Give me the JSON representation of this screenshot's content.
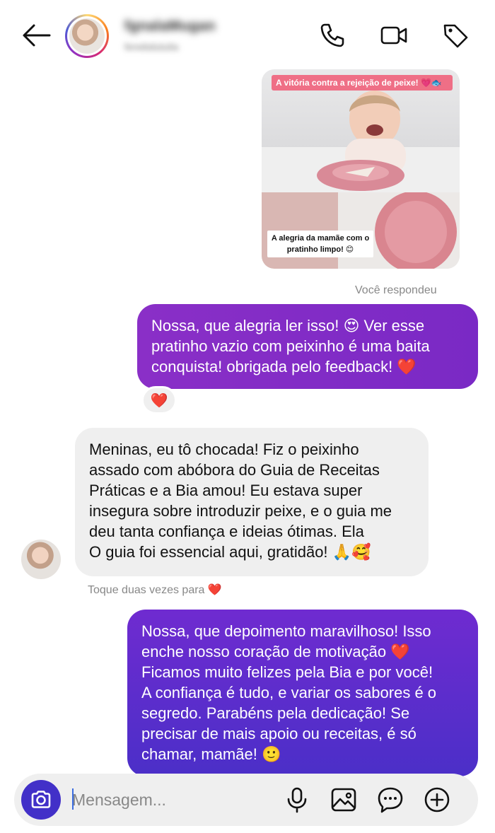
{
  "header": {
    "username": "fgnalaMugan",
    "handle": "fenebdutulia",
    "icons": [
      "back-arrow-icon",
      "phone-icon",
      "video-camera-icon",
      "tag-icon"
    ]
  },
  "shared_card": {
    "caption_top": "A vitória contra a rejeição de peixe! 💗🐟",
    "caption_bottom": "A alegria da mamãe com o pratinho limpo! 😊"
  },
  "meta": {
    "you_replied": "Você respondeu",
    "double_tap": "Toque duas vezes para ❤️"
  },
  "messages": {
    "out1": "Nossa, que alegria ler isso! 😍 Ver esse pratinho vazio com peixinho é uma baita conquista! obrigada pelo feedback! ❤️",
    "reaction": "❤️",
    "incoming_lines": [
      "Meninas, eu tô chocada! Fiz o peixinho",
      "assado com abóbora do Guia de Receitas",
      "Práticas e a Bia amou! Eu estava super",
      "insegura sobre introduzir peixe, e o guia me",
      "deu tanta confiança e ideias ótimas. Ela",
      "O guia foi essencial aqui, gratidão! 🙏🥰"
    ],
    "out2_lines": [
      "Nossa, que depoimento maravilhoso! Isso",
      "enche nosso coração de motivação ❤️",
      "Ficamos muito felizes pela Bia e por você!",
      "A confiança é tudo, e variar os sabores é o",
      "segredo. Parabéns pela dedicação! Se",
      "precisar de mais apoio ou receitas, é só",
      "chamar, mamãe! 🙂"
    ]
  },
  "composer": {
    "placeholder": "Mensagem...",
    "icons": [
      "camera-icon",
      "microphone-icon",
      "gallery-icon",
      "sticker-icon",
      "plus-icon"
    ]
  },
  "colors": {
    "outgoing_1": "#8a2fc7",
    "outgoing_2_top": "#6f2bd0",
    "outgoing_2_bottom": "#4b2fc8",
    "incoming": "#efefef",
    "camera_button": "#4230c8"
  }
}
